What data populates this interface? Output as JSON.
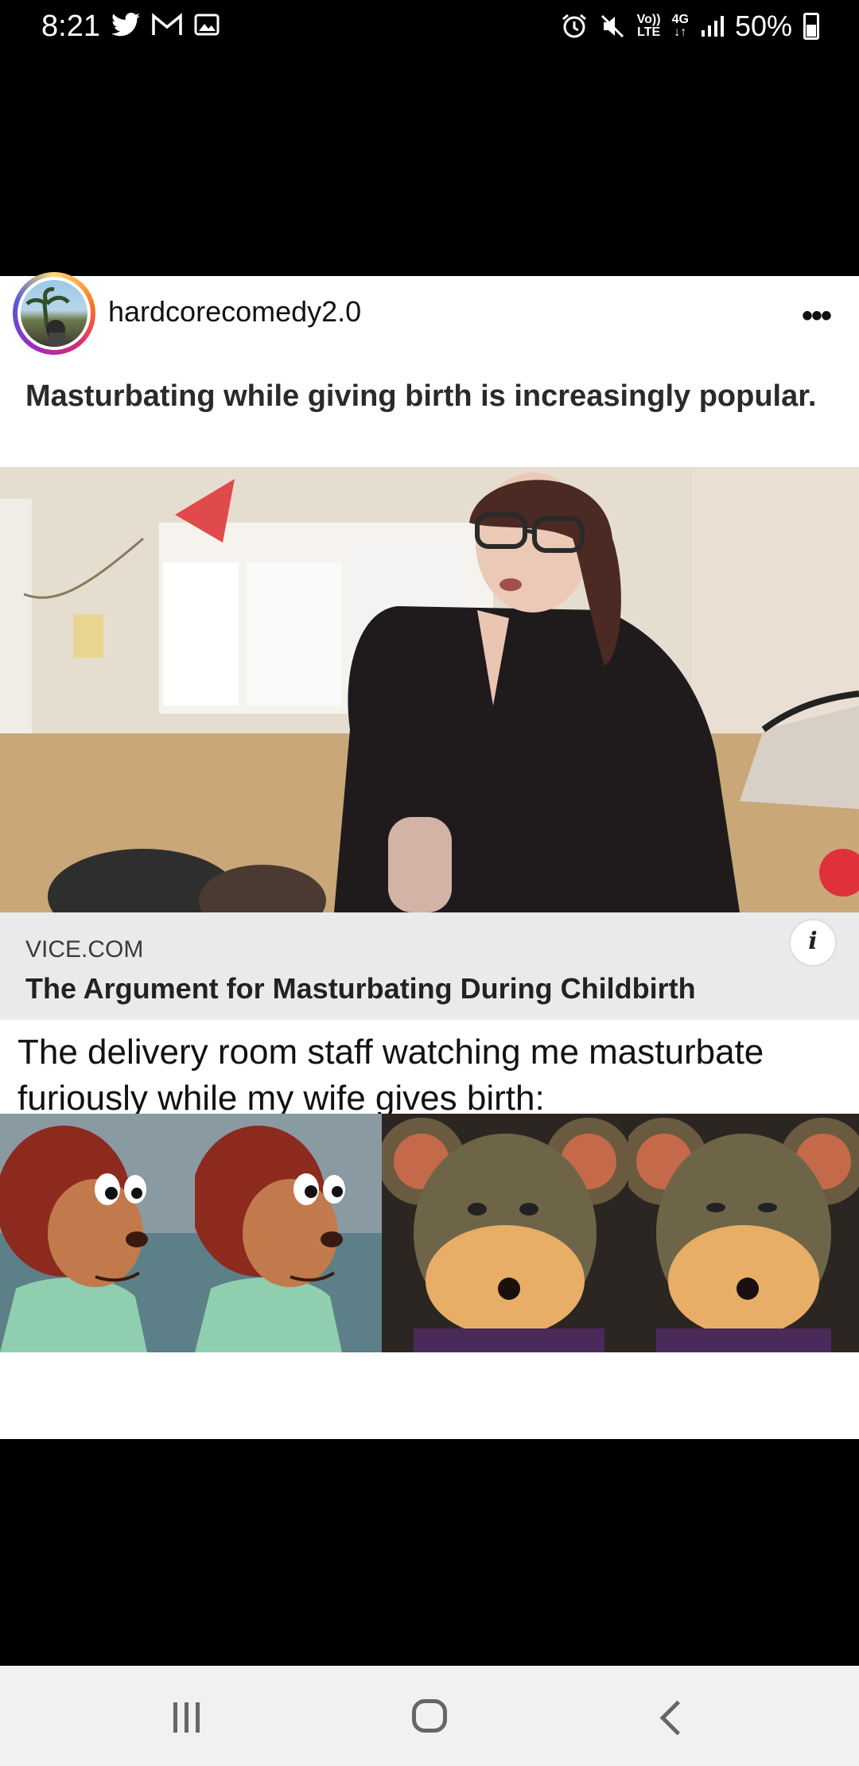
{
  "status_bar": {
    "time": "8:21",
    "left_icons": [
      "twitter-icon",
      "gmail-icon",
      "gallery-icon"
    ],
    "volte": "Vo))",
    "volte_sub": "LTE",
    "network": "4G",
    "battery": "50%"
  },
  "post": {
    "username": "hardcorecomedy2.0",
    "headline": "Masturbating while giving birth is increasingly popular.",
    "link_domain": "VICE.COM",
    "link_title": "The Argument for Masturbating During Childbirth",
    "caption": "The delivery room staff watching me masturbate furiously while my wife gives birth:"
  }
}
